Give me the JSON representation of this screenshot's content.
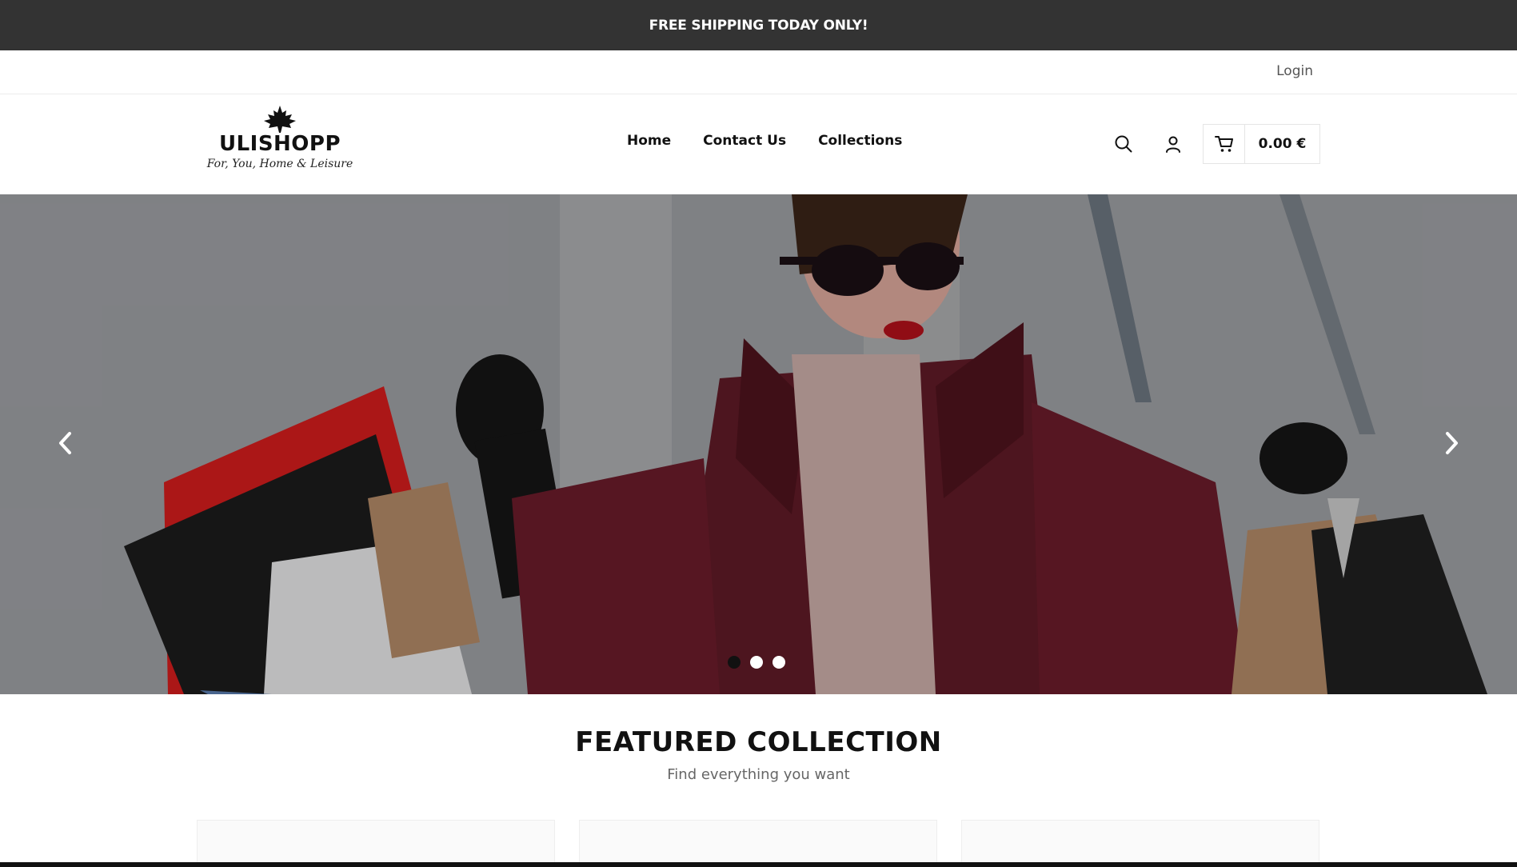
{
  "announcement": {
    "text": "FREE SHIPPING TODAY ONLY!",
    "background": "#333333"
  },
  "topbar": {
    "login_label": "Login"
  },
  "header": {
    "logo": {
      "brand": "ULISHOPP",
      "tagline": "For, You, Home & Leisure",
      "icon": "maple-leaf-icon"
    },
    "nav": [
      {
        "label": "Home"
      },
      {
        "label": "Contact Us"
      },
      {
        "label": "Collections"
      }
    ],
    "icons": {
      "search": "search-icon",
      "account": "user-icon",
      "cart": "cart-icon"
    },
    "cart_total": "0.00 €"
  },
  "hero": {
    "slides_count": 3,
    "active_slide": 1,
    "prev_icon": "chevron-left-icon",
    "next_icon": "chevron-right-icon"
  },
  "featured": {
    "title": "FEATURED COLLECTION",
    "subtitle": "Find everything you want"
  }
}
